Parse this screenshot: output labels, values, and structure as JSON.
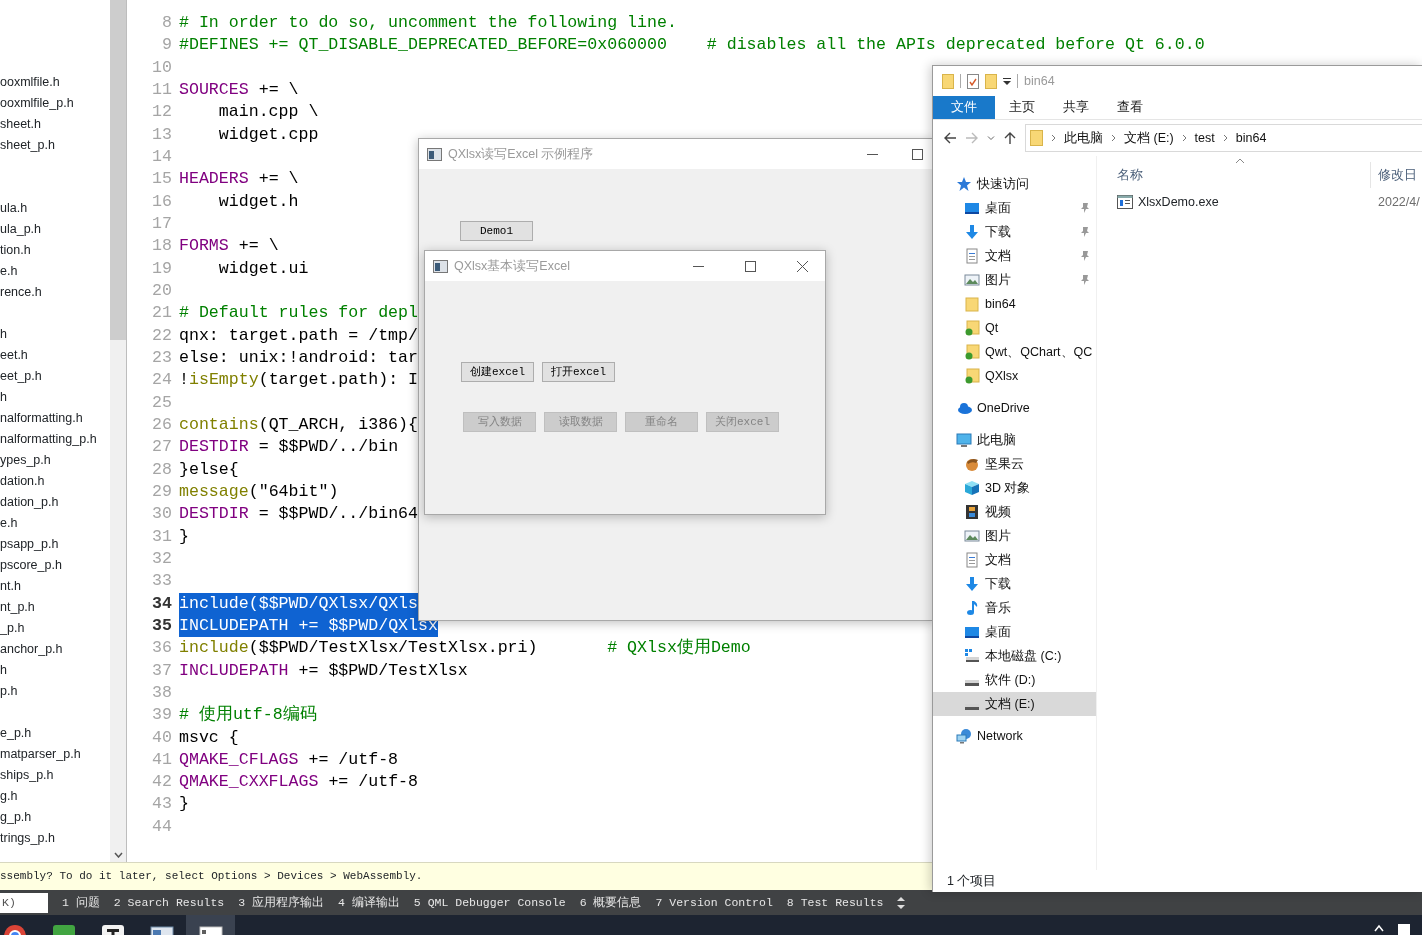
{
  "file_panel": {
    "items": [
      {
        "kind": "file",
        "label": "ooxmlfile.h"
      },
      {
        "kind": "file",
        "label": "ooxmlfile_p.h"
      },
      {
        "kind": "file",
        "label": "sheet.h"
      },
      {
        "kind": "file",
        "label": "sheet_p.h"
      },
      {
        "kind": "spacer"
      },
      {
        "kind": "spacer"
      },
      {
        "kind": "file",
        "label": "ula.h"
      },
      {
        "kind": "file",
        "label": "ula_p.h"
      },
      {
        "kind": "file",
        "label": "tion.h"
      },
      {
        "kind": "file",
        "label": "e.h"
      },
      {
        "kind": "file",
        "label": "rence.h"
      },
      {
        "kind": "spacer"
      },
      {
        "kind": "file",
        "label": "h"
      },
      {
        "kind": "file",
        "label": "eet.h"
      },
      {
        "kind": "file",
        "label": "eet_p.h"
      },
      {
        "kind": "file",
        "label": "h"
      },
      {
        "kind": "file",
        "label": "nalformatting.h"
      },
      {
        "kind": "file",
        "label": "nalformatting_p.h"
      },
      {
        "kind": "file",
        "label": "ypes_p.h"
      },
      {
        "kind": "file",
        "label": "dation.h"
      },
      {
        "kind": "file",
        "label": "dation_p.h"
      },
      {
        "kind": "file",
        "label": "e.h"
      },
      {
        "kind": "file",
        "label": "psapp_p.h"
      },
      {
        "kind": "file",
        "label": "pscore_p.h"
      },
      {
        "kind": "file",
        "label": "nt.h"
      },
      {
        "kind": "file",
        "label": "nt_p.h"
      },
      {
        "kind": "file",
        "label": "_p.h"
      },
      {
        "kind": "file",
        "label": "anchor_p.h"
      },
      {
        "kind": "file",
        "label": "h"
      },
      {
        "kind": "file",
        "label": "p.h"
      },
      {
        "kind": "spacer"
      },
      {
        "kind": "file",
        "label": "e_p.h"
      },
      {
        "kind": "file",
        "label": "matparser_p.h"
      },
      {
        "kind": "file",
        "label": "ships_p.h"
      },
      {
        "kind": "file",
        "label": "g.h"
      },
      {
        "kind": "file",
        "label": "g_p.h"
      },
      {
        "kind": "file",
        "label": "trings_p.h"
      }
    ]
  },
  "editor": {
    "lines": [
      {
        "number": "8",
        "selected": false,
        "tokens": [
          {
            "kind": "comment",
            "text": "# In order to do so, uncomment the following line."
          }
        ]
      },
      {
        "number": "9",
        "selected": false,
        "tokens": [
          {
            "kind": "comment",
            "text": "#DEFINES += QT_DISABLE_DEPRECATED_BEFORE=0x060000    # disables all the APIs deprecated before Qt 6.0.0"
          }
        ]
      },
      {
        "number": "10",
        "selected": false
      },
      {
        "number": "11",
        "selected": false,
        "tokens": [
          {
            "kind": "keyword",
            "text": "SOURCES"
          },
          {
            "kind": "plain",
            "text": " += \\"
          }
        ]
      },
      {
        "number": "12",
        "selected": false,
        "tokens": [
          {
            "kind": "plain",
            "text": "    main.cpp \\"
          }
        ]
      },
      {
        "number": "13",
        "selected": false,
        "tokens": [
          {
            "kind": "plain",
            "text": "    widget.cpp"
          }
        ]
      },
      {
        "number": "14",
        "selected": false
      },
      {
        "number": "15",
        "selected": false,
        "tokens": [
          {
            "kind": "keyword",
            "text": "HEADERS"
          },
          {
            "kind": "plain",
            "text": " += \\"
          }
        ]
      },
      {
        "number": "16",
        "selected": false,
        "tokens": [
          {
            "kind": "plain",
            "text": "    widget.h"
          }
        ]
      },
      {
        "number": "17",
        "selected": false
      },
      {
        "number": "18",
        "selected": false,
        "tokens": [
          {
            "kind": "keyword",
            "text": "FORMS"
          },
          {
            "kind": "plain",
            "text": " += \\"
          }
        ]
      },
      {
        "number": "19",
        "selected": false,
        "tokens": [
          {
            "kind": "plain",
            "text": "    widget.ui"
          }
        ]
      },
      {
        "number": "20",
        "selected": false
      },
      {
        "number": "21",
        "selected": false,
        "tokens": [
          {
            "kind": "comment",
            "text": "# Default rules for depl"
          }
        ]
      },
      {
        "number": "22",
        "selected": false,
        "tokens": [
          {
            "kind": "plain",
            "text": "qnx: target.path = /tmp/"
          }
        ]
      },
      {
        "number": "23",
        "selected": false,
        "tokens": [
          {
            "kind": "plain",
            "text": "else: unix:!android: tar"
          }
        ]
      },
      {
        "number": "24",
        "selected": false,
        "tokens": [
          {
            "kind": "plain",
            "text": "!"
          },
          {
            "kind": "function",
            "text": "isEmpty"
          },
          {
            "kind": "plain",
            "text": "(target.path): I"
          }
        ]
      },
      {
        "number": "25",
        "selected": false
      },
      {
        "number": "26",
        "selected": false,
        "tokens": [
          {
            "kind": "function",
            "text": "contains"
          },
          {
            "kind": "plain",
            "text": "(QT_ARCH, i386){"
          }
        ]
      },
      {
        "number": "27",
        "selected": false,
        "tokens": [
          {
            "kind": "keyword",
            "text": "DESTDIR"
          },
          {
            "kind": "plain",
            "text": " = $$PWD/../bin"
          }
        ]
      },
      {
        "number": "28",
        "selected": false,
        "tokens": [
          {
            "kind": "plain",
            "text": "}else{"
          }
        ]
      },
      {
        "number": "29",
        "selected": false,
        "tokens": [
          {
            "kind": "function",
            "text": "message"
          },
          {
            "kind": "plain",
            "text": "(\"64bit\")"
          }
        ]
      },
      {
        "number": "30",
        "selected": false,
        "tokens": [
          {
            "kind": "keyword",
            "text": "DESTDIR"
          },
          {
            "kind": "plain",
            "text": " = $$PWD/../bin64"
          }
        ]
      },
      {
        "number": "31",
        "selected": false,
        "tokens": [
          {
            "kind": "plain",
            "text": "}"
          }
        ]
      },
      {
        "number": "32",
        "selected": false
      },
      {
        "number": "33",
        "selected": false
      },
      {
        "number": "34",
        "selected": true,
        "tokens": [
          {
            "kind": "function",
            "text": "include"
          },
          {
            "kind": "plain",
            "text": "($$PWD/QXlsx/QXls"
          }
        ]
      },
      {
        "number": "35",
        "selected": true,
        "tokens": [
          {
            "kind": "keyword",
            "text": "INCLUDEPATH"
          },
          {
            "kind": "plain",
            "text": " += $$PWD/QXlsx"
          }
        ]
      },
      {
        "number": "36",
        "selected": false,
        "tokens": [
          {
            "kind": "function",
            "text": "include"
          },
          {
            "kind": "plain",
            "text": "($$PWD/TestXlsx/TestXlsx.pri)       "
          },
          {
            "kind": "comment",
            "text": "# QXlsx使用Demo"
          }
        ]
      },
      {
        "number": "37",
        "selected": false,
        "tokens": [
          {
            "kind": "keyword",
            "text": "INCLUDEPATH"
          },
          {
            "kind": "plain",
            "text": " += $$PWD/TestXlsx"
          }
        ]
      },
      {
        "number": "38",
        "selected": false
      },
      {
        "number": "39",
        "selected": false,
        "tokens": [
          {
            "kind": "comment",
            "text": "# 使用utf-8编码"
          }
        ]
      },
      {
        "number": "40",
        "selected": false,
        "tokens": [
          {
            "kind": "plain",
            "text": "msvc {"
          }
        ]
      },
      {
        "number": "41",
        "selected": false,
        "tokens": [
          {
            "kind": "keyword",
            "text": "QMAKE_CFLAGS"
          },
          {
            "kind": "plain",
            "text": " += /utf-8"
          }
        ]
      },
      {
        "number": "42",
        "selected": false,
        "tokens": [
          {
            "kind": "keyword",
            "text": "QMAKE_CXXFLAGS"
          },
          {
            "kind": "plain",
            "text": " += /utf-8"
          }
        ]
      },
      {
        "number": "43",
        "selected": false,
        "tokens": [
          {
            "kind": "plain",
            "text": "}"
          }
        ]
      },
      {
        "number": "44",
        "selected": false
      }
    ]
  },
  "message_bar": {
    "text": "ssembly? To do it later, select Options > Devices > WebAssembly."
  },
  "output_bar": {
    "locator": {
      "placeholder": "K)"
    },
    "tabs": [
      "1 问题",
      "2 Search Results",
      "3 应用程序输出",
      "4 编译输出",
      "5 QML Debugger Console",
      "6 概要信息",
      "7 Version Control",
      "8 Test Results"
    ]
  },
  "taskbar": {
    "apps": [
      {
        "selected": false
      },
      {
        "selected": false
      },
      {
        "selected": false
      },
      {
        "selected": false
      },
      {
        "selected": true
      }
    ]
  },
  "dialogs": [
    {
      "title": "QXlsx读写Excel 示例程序",
      "button_rows": [
        [
          {
            "label": "Demo1",
            "disabled": false
          }
        ]
      ]
    },
    {
      "title": "QXlsx基本读写Excel",
      "button_rows": [
        [
          {
            "label": "创建excel",
            "disabled": false
          },
          {
            "label": "打开excel",
            "disabled": false
          }
        ],
        [
          {
            "label": "写入数据",
            "disabled": true
          },
          {
            "label": "读取数据",
            "disabled": true
          },
          {
            "label": "重命名",
            "disabled": true
          },
          {
            "label": "关闭excel",
            "disabled": true
          }
        ]
      ]
    }
  ],
  "explorer": {
    "title": "bin64",
    "ribbon_tabs": [
      {
        "label": "文件",
        "selected": true
      },
      {
        "label": "主页",
        "selected": false
      },
      {
        "label": "共享",
        "selected": false
      },
      {
        "label": "查看",
        "selected": false
      }
    ],
    "address": [
      "此电脑",
      "文档 (E:)",
      "test",
      "bin64"
    ],
    "nav": [
      {
        "label": "快速访问",
        "selected": false,
        "children": [
          {
            "label": "桌面",
            "selected": false,
            "pinned": true
          },
          {
            "label": "下载",
            "selected": false,
            "pinned": true
          },
          {
            "label": "文档",
            "selected": false,
            "pinned": true
          },
          {
            "label": "图片",
            "selected": false,
            "pinned": true
          },
          {
            "label": "bin64",
            "selected": false,
            "pinned": false
          },
          {
            "label": "Qt",
            "selected": false,
            "pinned": false
          },
          {
            "label": "Qwt、QChart、QC",
            "selected": false,
            "pinned": false
          },
          {
            "label": "QXlsx",
            "selected": false,
            "pinned": false
          }
        ]
      },
      {
        "label": "OneDrive",
        "selected": false
      },
      {
        "label": "此电脑",
        "selected": false,
        "children": [
          {
            "label": "坚果云",
            "selected": false
          },
          {
            "label": "3D 对象",
            "selected": false
          },
          {
            "label": "视频",
            "selected": false
          },
          {
            "label": "图片",
            "selected": false
          },
          {
            "label": "文档",
            "selected": false
          },
          {
            "label": "下载",
            "selected": false
          },
          {
            "label": "音乐",
            "selected": false
          },
          {
            "label": "桌面",
            "selected": false
          },
          {
            "label": "本地磁盘 (C:)",
            "selected": false
          },
          {
            "label": "软件 (D:)",
            "selected": false
          },
          {
            "label": "文档 (E:)",
            "selected": true
          }
        ]
      },
      {
        "label": "Network",
        "selected": false
      }
    ],
    "columns": [
      "名称",
      "修改日"
    ],
    "files": [
      {
        "name": "XlsxDemo.exe",
        "modified": "2022/4/"
      }
    ],
    "status": "1 个项目"
  }
}
